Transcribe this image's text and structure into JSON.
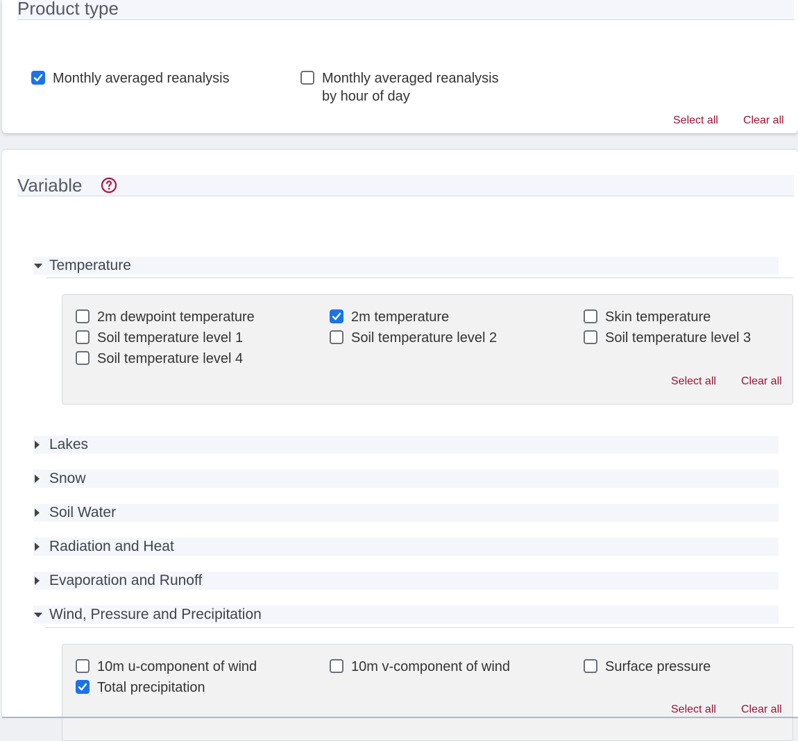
{
  "product_type": {
    "title": "Product type",
    "options": [
      {
        "label_line1": "Monthly averaged reanalysis",
        "label_line2": "",
        "checked": true
      },
      {
        "label_line1": "Monthly averaged reanalysis",
        "label_line2": "by hour of day",
        "checked": false
      }
    ],
    "select_all": "Select all",
    "clear_all": "Clear all"
  },
  "variable": {
    "title": "Variable",
    "help_icon": "question-circle-icon",
    "groups": [
      {
        "name": "Temperature",
        "expanded": true,
        "items": [
          {
            "label": "2m dewpoint temperature",
            "checked": false
          },
          {
            "label": "2m temperature",
            "checked": true
          },
          {
            "label": "Skin temperature",
            "checked": false
          },
          {
            "label": "Soil temperature level 1",
            "checked": false
          },
          {
            "label": "Soil temperature level 2",
            "checked": false
          },
          {
            "label": "Soil temperature level 3",
            "checked": false
          },
          {
            "label": "Soil temperature level 4",
            "checked": false
          }
        ],
        "select_all": "Select all",
        "clear_all": "Clear all"
      },
      {
        "name": "Lakes",
        "expanded": false
      },
      {
        "name": "Snow",
        "expanded": false
      },
      {
        "name": "Soil Water",
        "expanded": false
      },
      {
        "name": "Radiation and Heat",
        "expanded": false
      },
      {
        "name": "Evaporation and Runoff",
        "expanded": false
      },
      {
        "name": "Wind, Pressure and Precipitation",
        "expanded": true,
        "items": [
          {
            "label": "10m u-component of wind",
            "checked": false
          },
          {
            "label": "10m v-component of wind",
            "checked": false
          },
          {
            "label": "Surface pressure",
            "checked": false
          },
          {
            "label": "Total precipitation",
            "checked": true
          }
        ],
        "select_all": "Select all",
        "clear_all": "Clear all"
      }
    ]
  },
  "colors": {
    "accent_link": "#9b1233",
    "checkbox_checked": "#1a73e8",
    "section_header_bg": "#f4f6fb"
  }
}
